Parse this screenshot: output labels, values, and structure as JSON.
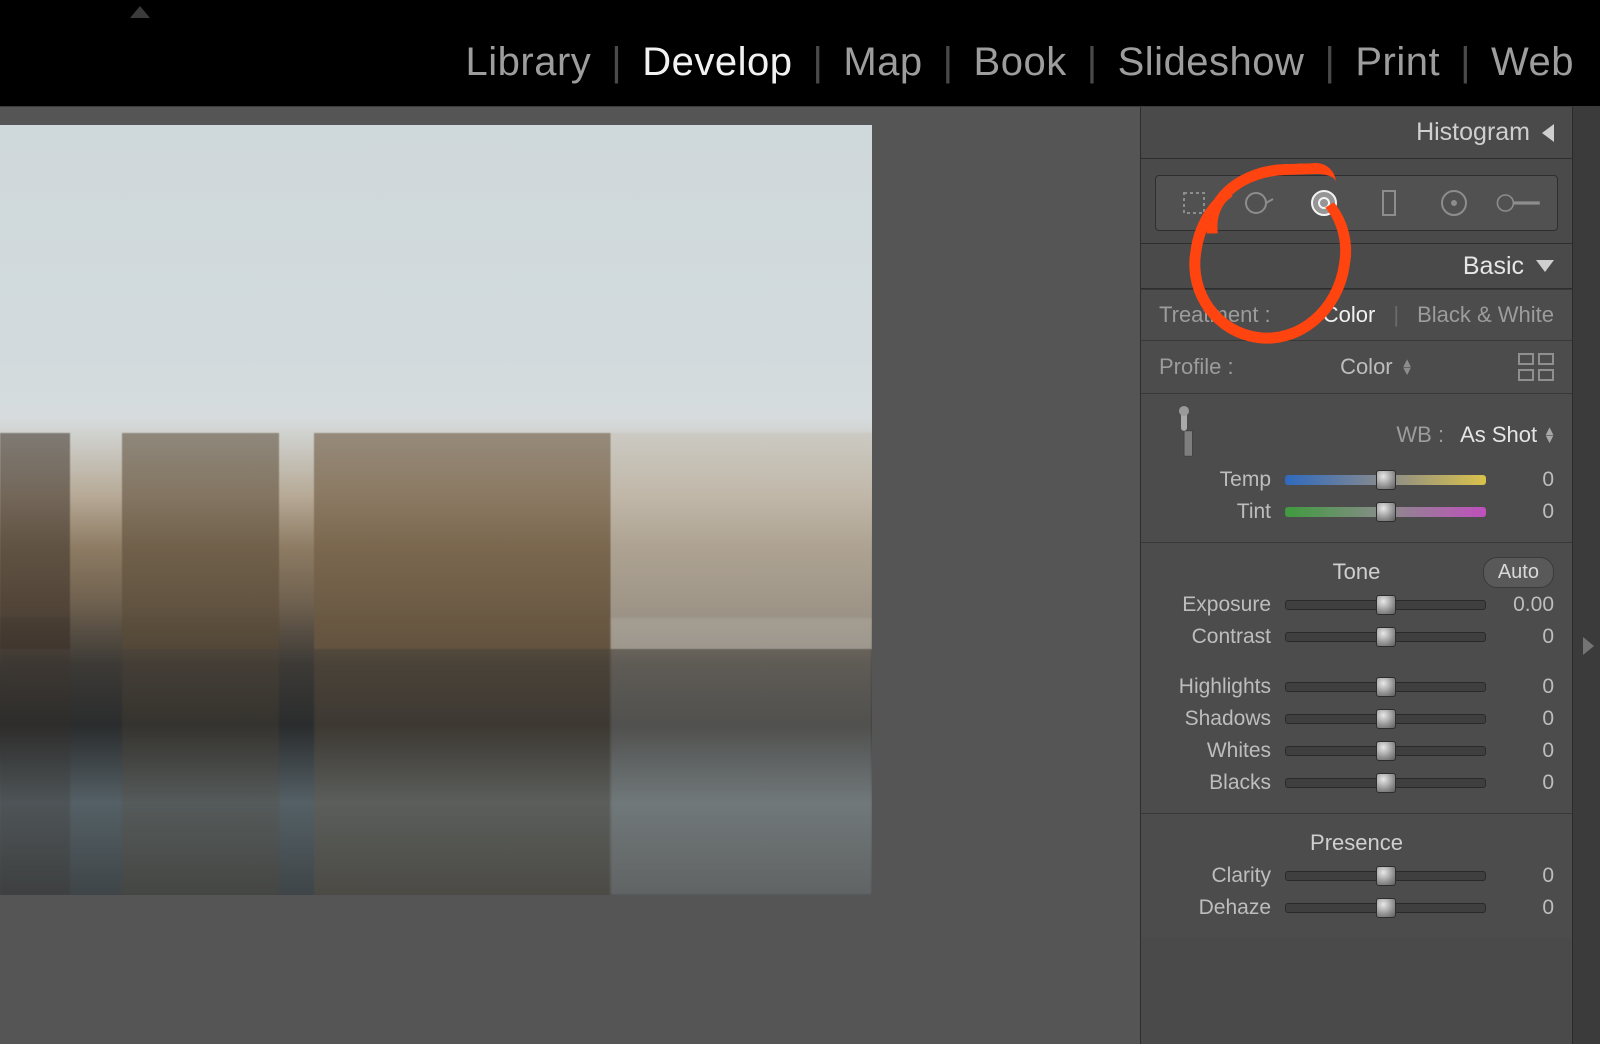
{
  "modules": {
    "library": "Library",
    "develop": "Develop",
    "map": "Map",
    "book": "Book",
    "slideshow": "Slideshow",
    "print": "Print",
    "web": "Web",
    "active": "develop"
  },
  "panels": {
    "histogram": "Histogram",
    "basic": "Basic"
  },
  "treatment": {
    "label": "Treatment :",
    "color": "Color",
    "bw": "Black & White"
  },
  "profile": {
    "label": "Profile :",
    "value": "Color"
  },
  "wb": {
    "label": "WB :",
    "value": "As Shot",
    "temp": {
      "label": "Temp",
      "value": "0",
      "pos": 50
    },
    "tint": {
      "label": "Tint",
      "value": "0",
      "pos": 50
    }
  },
  "tone": {
    "label": "Tone",
    "auto": "Auto",
    "exposure": {
      "label": "Exposure",
      "value": "0.00",
      "pos": 50
    },
    "contrast": {
      "label": "Contrast",
      "value": "0",
      "pos": 50
    },
    "highlights": {
      "label": "Highlights",
      "value": "0",
      "pos": 50
    },
    "shadows": {
      "label": "Shadows",
      "value": "0",
      "pos": 50
    },
    "whites": {
      "label": "Whites",
      "value": "0",
      "pos": 50
    },
    "blacks": {
      "label": "Blacks",
      "value": "0",
      "pos": 50
    }
  },
  "presence": {
    "label": "Presence",
    "clarity": {
      "label": "Clarity",
      "value": "0",
      "pos": 50
    },
    "dehaze": {
      "label": "Dehaze",
      "value": "0",
      "pos": 50
    }
  }
}
